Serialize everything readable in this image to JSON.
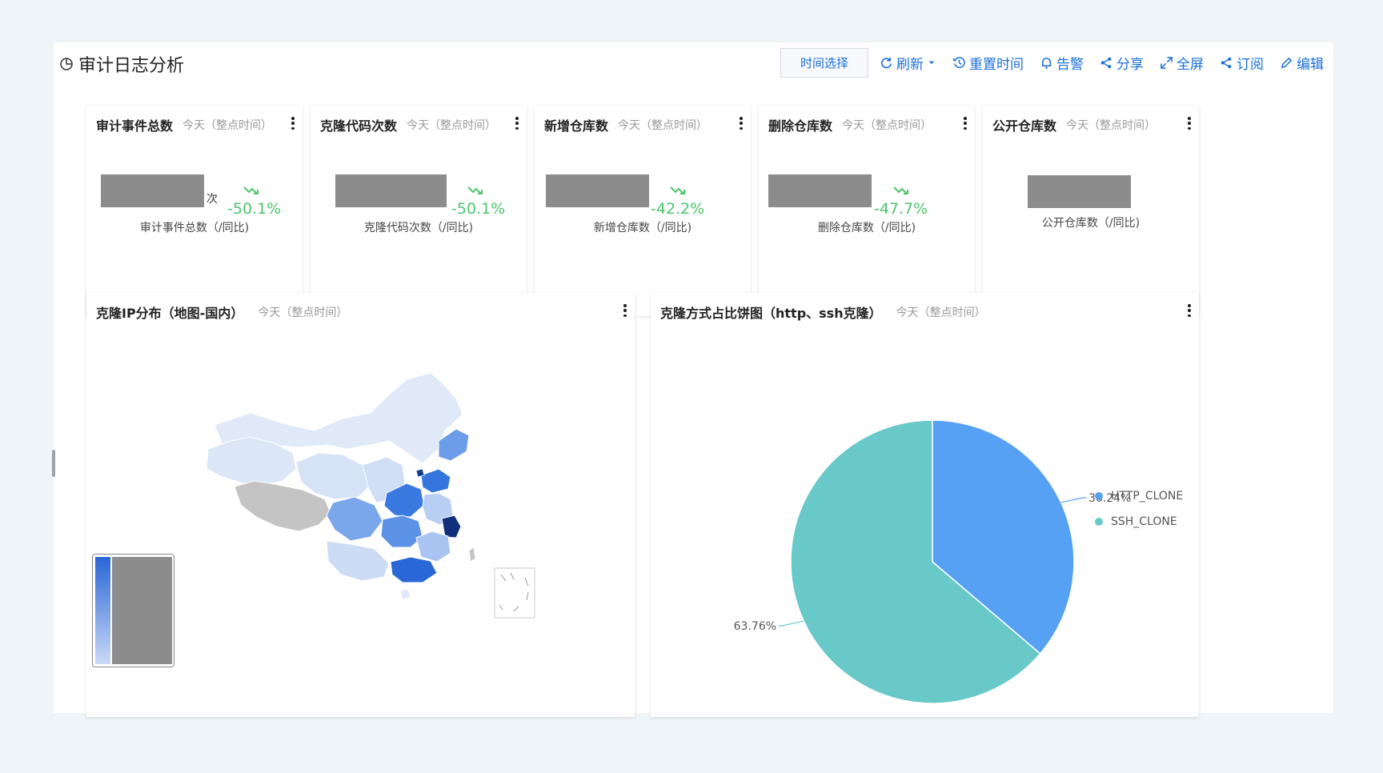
{
  "header": {
    "title": "审计日志分析",
    "toolbar": {
      "time_select": "时间选择",
      "refresh": "刷新",
      "reset_time": "重置时间",
      "alert": "告警",
      "share": "分享",
      "fullscreen": "全屏",
      "subscribe": "订阅",
      "edit": "编辑"
    }
  },
  "kpis": [
    {
      "title": "审计事件总数",
      "sub": "今天（整点时间）",
      "unit": "次",
      "pct": "-50.1%",
      "label": "审计事件总数（/同比)"
    },
    {
      "title": "克隆代码次数",
      "sub": "今天（整点时间）",
      "unit": "",
      "pct": "-50.1%",
      "label": "克隆代码次数（/同比)"
    },
    {
      "title": "新增仓库数",
      "sub": "今天（整点时间）",
      "unit": "",
      "pct": "-42.2%",
      "label": "新增仓库数（/同比)"
    },
    {
      "title": "删除仓库数",
      "sub": "今天（整点时间）",
      "unit": "",
      "pct": "-47.7%",
      "label": "删除仓库数（/同比)"
    },
    {
      "title": "公开仓库数",
      "sub": "今天（整点时间）",
      "unit": "",
      "pct": "",
      "label": "公开仓库数（/同比)"
    }
  ],
  "map_panel": {
    "title": "克隆IP分布（地图-国内）",
    "sub": "今天（整点时间）"
  },
  "pie_panel": {
    "title": "克隆方式占比饼图（http、ssh克隆）",
    "sub": "今天（整点时间）"
  },
  "chart_data": {
    "type": "pie",
    "title": "克隆方式占比饼图（http、ssh克隆）",
    "slices": [
      {
        "name": "HTTP_CLONE",
        "value": 36.24,
        "label": "36.24%",
        "color": "#56a1f3"
      },
      {
        "name": "SSH_CLONE",
        "value": 63.76,
        "label": "63.76%",
        "color": "#68c9c8"
      }
    ],
    "legend_position": "right"
  },
  "colors": {
    "accent": "#1a6fd8",
    "trend_down": "#4cc66b",
    "redacted": "#8c8c8c"
  }
}
